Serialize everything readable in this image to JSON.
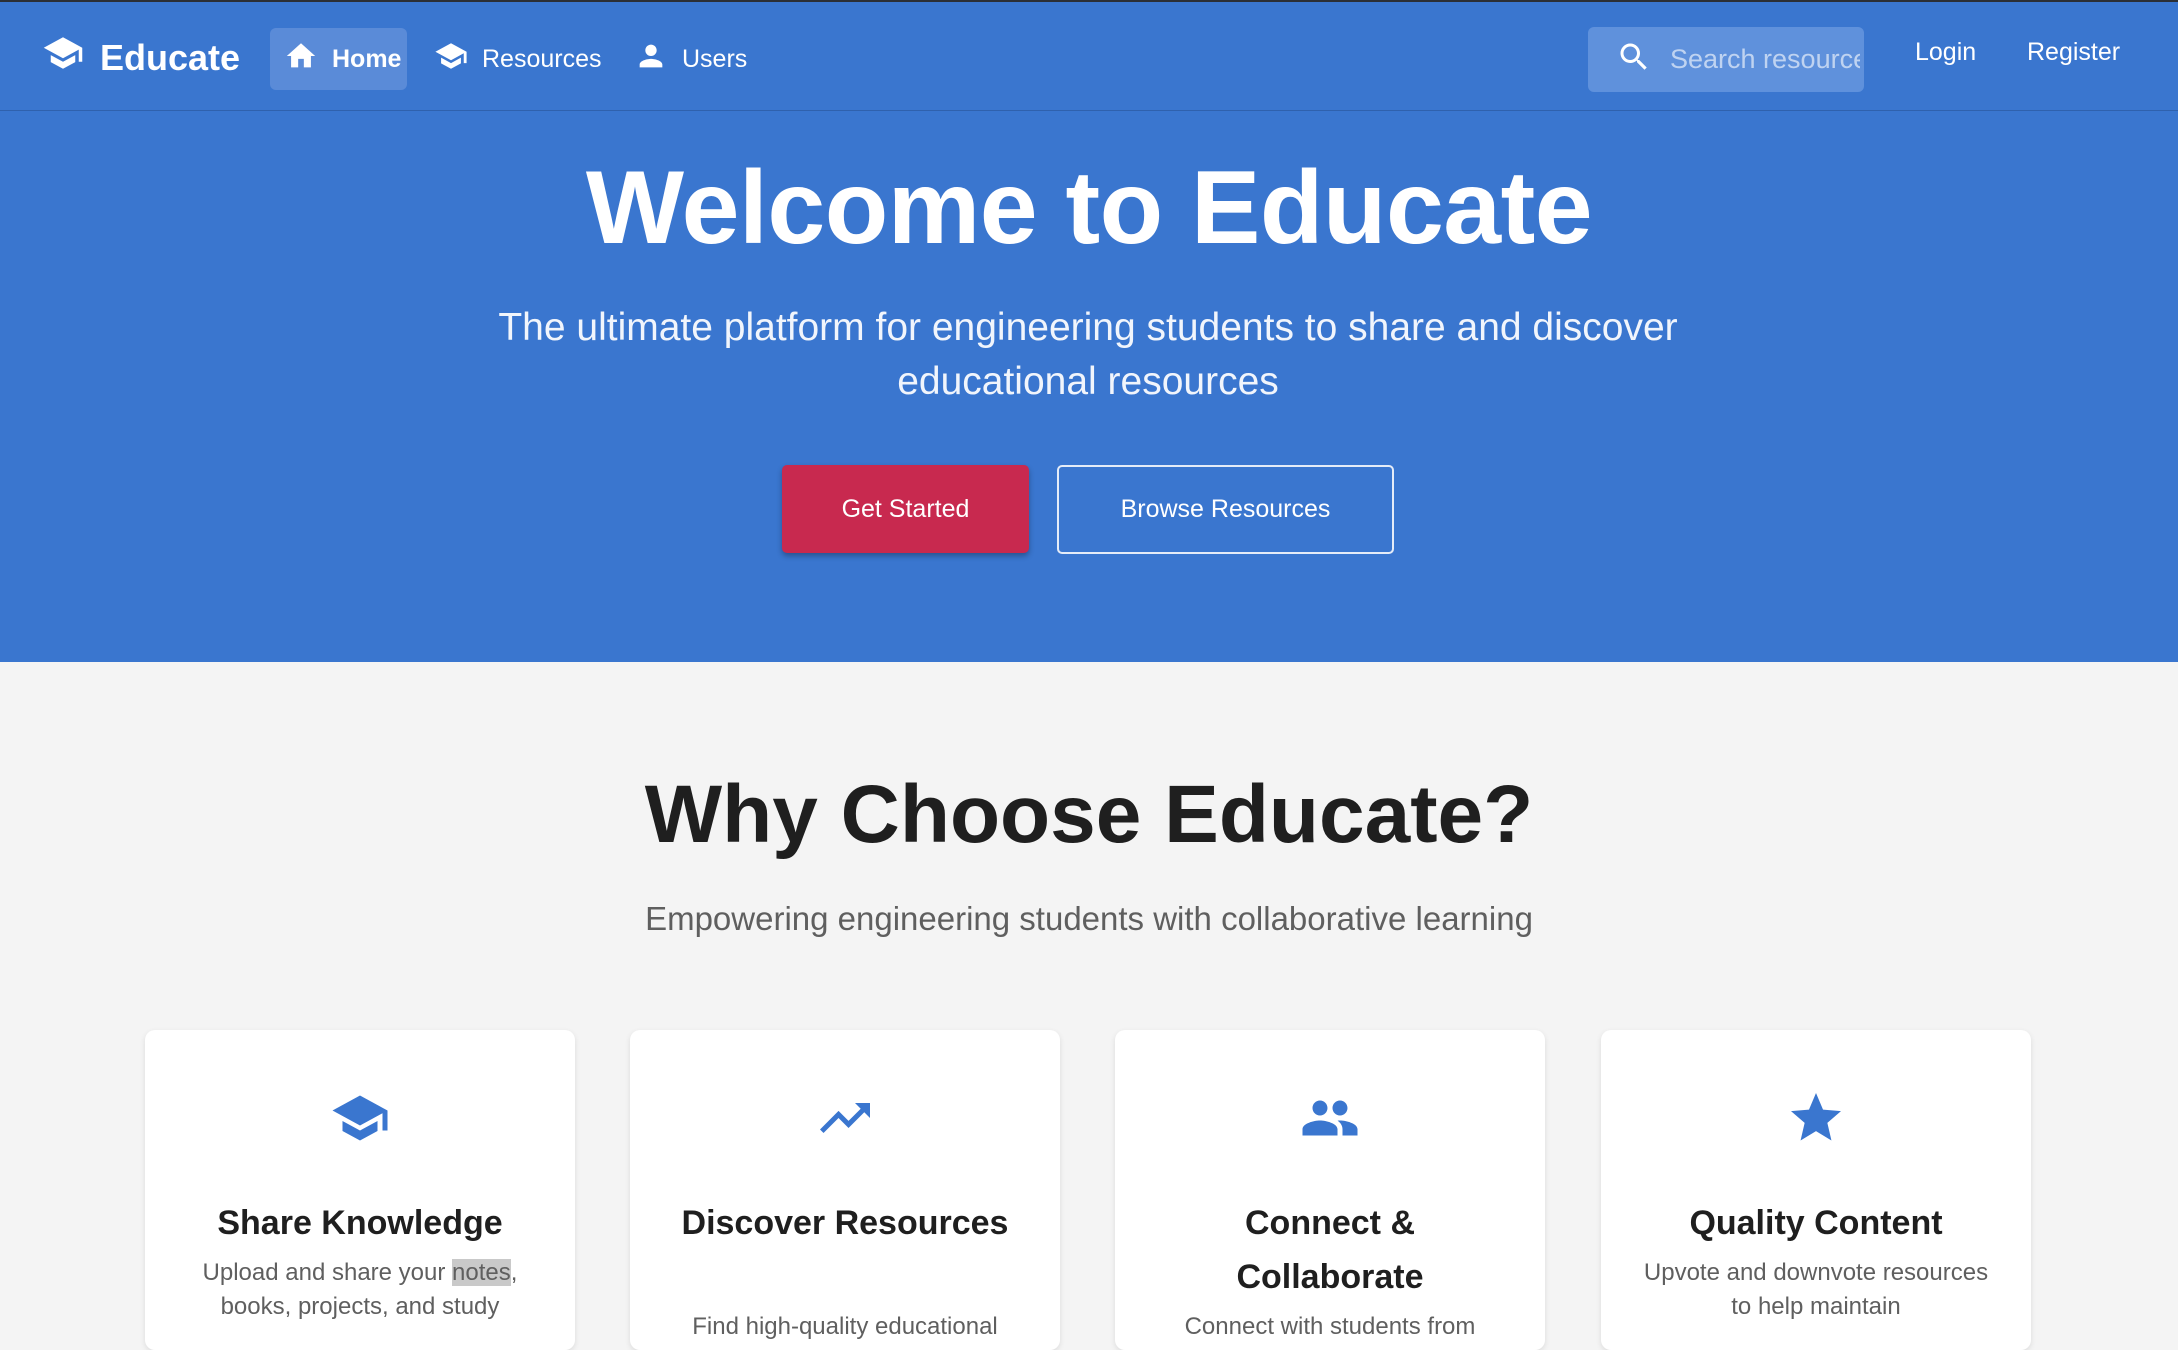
{
  "app": {
    "name": "Educate"
  },
  "nav": {
    "home": "Home",
    "resources": "Resources",
    "users": "Users"
  },
  "search": {
    "placeholder": "Search resources"
  },
  "auth": {
    "login": "Login",
    "register": "Register"
  },
  "hero": {
    "title": "Welcome to Educate",
    "subtitle": "The ultimate platform for engineering students to share and discover educational resources",
    "primary_cta": "Get Started",
    "secondary_cta": "Browse Resources"
  },
  "why": {
    "title": "Why Choose Educate?",
    "subtitle": "Empowering engineering students with collaborative learning"
  },
  "features": [
    {
      "icon": "graduation-cap-icon",
      "title": "Share Knowledge",
      "desc_pre": "Upload and share your ",
      "desc_highlight": "notes",
      "desc_post": ", books, projects, and study"
    },
    {
      "icon": "trending-up-icon",
      "title": "Discover Resources",
      "desc": "Find high-quality educational"
    },
    {
      "icon": "people-icon",
      "title": "Connect & Collaborate",
      "desc": "Connect with students from"
    },
    {
      "icon": "star-icon",
      "title": "Quality Content",
      "desc": "Upvote and downvote resources to help maintain"
    }
  ],
  "colors": {
    "primary": "#3a76cf",
    "accent": "#c8294f",
    "background": "#f4f4f4"
  }
}
